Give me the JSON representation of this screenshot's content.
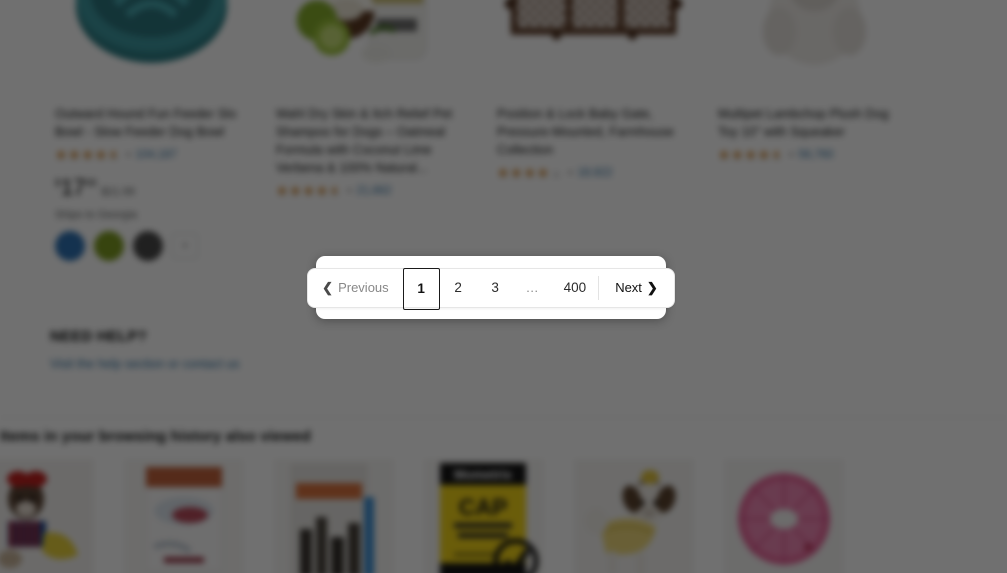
{
  "results": {
    "products": [
      {
        "title": "Outward Hound Fun Feeder Slo Bowl - Slow Feeder Dog Bowl",
        "rating_value": 4.5,
        "rating_count": "104,187",
        "price_symbol": "$",
        "price_whole": "17",
        "price_fraction": "49",
        "price_was": "$21.99",
        "ships_to": "Ships to Georgia",
        "swatches": [
          "#2f72b3",
          "#7d9b22",
          "#4a4a4a"
        ],
        "swatch_more": "+",
        "image_name": "teal-slow-feeder-dog-bowl"
      },
      {
        "title": "Wahl Dry Skin & Itch Relief Pet Shampoo for Dogs – Oatmeal Formula with Coconut Lime Verbena & 100% Natural...",
        "rating_value": 4.5,
        "rating_count": "21,662",
        "image_name": "pet-shampoo-coconut-lime-bottle"
      },
      {
        "title": "Position & Lock Baby Gate, Pressure-Mounted, Farmhouse Collection",
        "rating_value": 4.0,
        "rating_count": "18,922",
        "image_name": "farmhouse-baby-gate"
      },
      {
        "title": "Multipet Lambchop Plush Dog Toy 10\" with Squeaker",
        "rating_value": 4.5,
        "rating_count": "56,760",
        "image_name": "lambchop-plush-dog-toy"
      }
    ]
  },
  "pagination": {
    "previous_label": "Previous",
    "previous_icon": "chevron-left-icon",
    "next_label": "Next",
    "next_icon": "chevron-right-icon",
    "pages": [
      "1",
      "2",
      "3"
    ],
    "ellipsis": "…",
    "last_page": "400",
    "current_page": "1"
  },
  "need_help": {
    "title": "NEED HELP?",
    "link_text": "Visit the help section or contact us"
  },
  "browsing_history": {
    "title": "Items in your browsing history also viewed",
    "items": [
      {
        "image_name": "dog-snow-white-costume"
      },
      {
        "image_name": "pink-package-product"
      },
      {
        "image_name": "city-skyline-book-cover"
      },
      {
        "image_name": "mometrix-cap-exam-study-guide"
      },
      {
        "image_name": "dog-belle-yellow-costume"
      },
      {
        "image_name": "pink-tutu-pet-skirt"
      }
    ]
  }
}
